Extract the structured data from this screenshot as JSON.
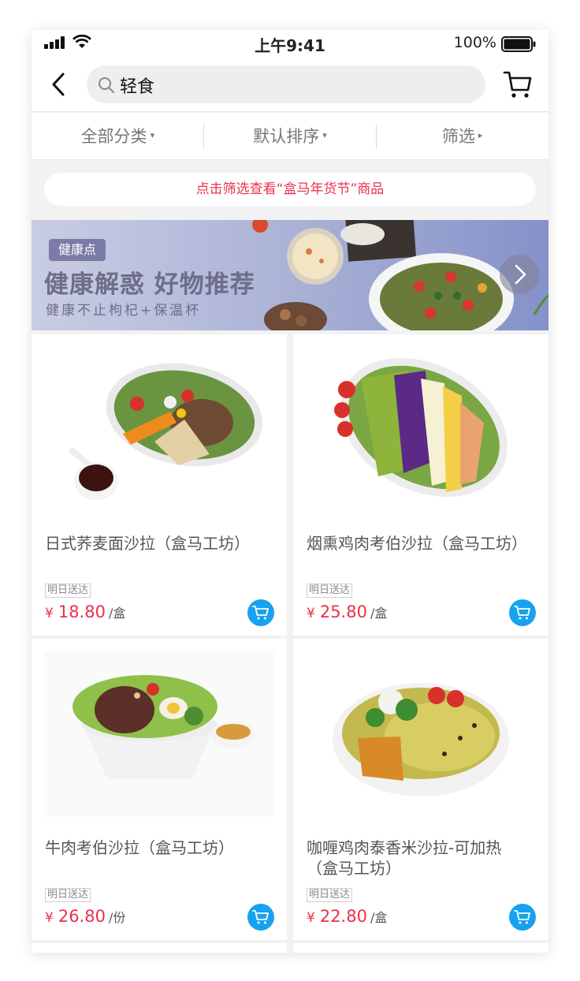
{
  "status": {
    "time": "上午9:41",
    "battery": "100%"
  },
  "search": {
    "query": "轻食"
  },
  "filters": [
    {
      "label": "全部分类",
      "arrow": "▾"
    },
    {
      "label": "默认排序",
      "arrow": "▾"
    },
    {
      "label": "筛选",
      "arrow": "▸"
    }
  ],
  "notice": "点击筛选查看“盒马年货节”商品",
  "banner": {
    "badge": "健康点",
    "title": "健康解惑 好物推荐",
    "subtitle": "健康不止枸杞+保温杯"
  },
  "products": [
    {
      "name": "日式荞麦面沙拉（盒马工坊）",
      "tag": "明日送达",
      "currency": "¥",
      "price": "18.80",
      "unit": "/盒"
    },
    {
      "name": "烟熏鸡肉考伯沙拉（盒马工坊）",
      "tag": "明日送达",
      "currency": "¥",
      "price": "25.80",
      "unit": "/盒"
    },
    {
      "name": "牛肉考伯沙拉（盒马工坊）",
      "tag": "明日送达",
      "currency": "¥",
      "price": "26.80",
      "unit": "/份"
    },
    {
      "name": "咖喱鸡肉泰香米沙拉-可加热（盒马工坊）",
      "tag": "明日送达",
      "currency": "¥",
      "price": "22.80",
      "unit": "/盒"
    }
  ],
  "colors": {
    "accent_red": "#e8314a",
    "cart_blue": "#16a2f0"
  },
  "icons": [
    "signal-icon",
    "wifi-icon",
    "battery-icon",
    "back-icon",
    "search-icon",
    "cart-icon",
    "chevron-right-icon",
    "add-to-cart-icon"
  ]
}
